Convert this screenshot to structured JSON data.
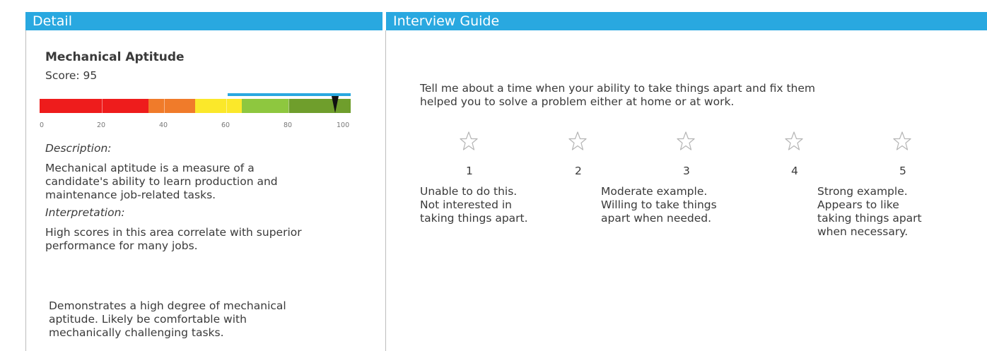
{
  "headers": {
    "detail": "Detail",
    "interview_guide": "Interview Guide"
  },
  "detail": {
    "title": "Mechanical Aptitude",
    "score_label": "Score: 95",
    "score_value": 95,
    "scale_labels": [
      "0",
      "20",
      "40",
      "60",
      "80",
      "100"
    ],
    "description_heading": "Description:",
    "description_lines": [
      "Mechanical aptitude is a measure of a",
      "candidate's ability to learn production and",
      "maintenance job-related tasks."
    ],
    "interpretation_heading": "Interpretation:",
    "interpretation_lines": [
      "High scores in this area correlate with superior",
      "performance for many jobs."
    ],
    "summary_lines": [
      "Demonstrates a high degree of mechanical",
      "aptitude. Likely be comfortable with",
      "mechanically challenging tasks."
    ]
  },
  "gauge": {
    "band_colors": [
      "#ee1c1c",
      "#f07b2a",
      "#fbe82a",
      "#8ec73f",
      "#6f9e2c"
    ],
    "band_ranges": [
      [
        0,
        35
      ],
      [
        35,
        50
      ],
      [
        50,
        65
      ],
      [
        65,
        80
      ],
      [
        80,
        100
      ]
    ],
    "highlight_range": [
      60,
      100
    ],
    "highlight_color": "#29a8e0",
    "marker_value": 95
  },
  "guide": {
    "question_lines": [
      "Tell me about a time when your ability to take things apart and fix them",
      "helped you to solve a problem either at home or at work."
    ],
    "ratings": [
      "1",
      "2",
      "3",
      "4",
      "5"
    ],
    "anchors": [
      [
        "Unable to do this.",
        "Not interested in",
        "taking things apart."
      ],
      [
        "Moderate example.",
        "Willing to take things",
        "apart when needed."
      ],
      [
        "Strong example.",
        "Appears to like",
        "taking things apart",
        "when necessary."
      ]
    ]
  }
}
